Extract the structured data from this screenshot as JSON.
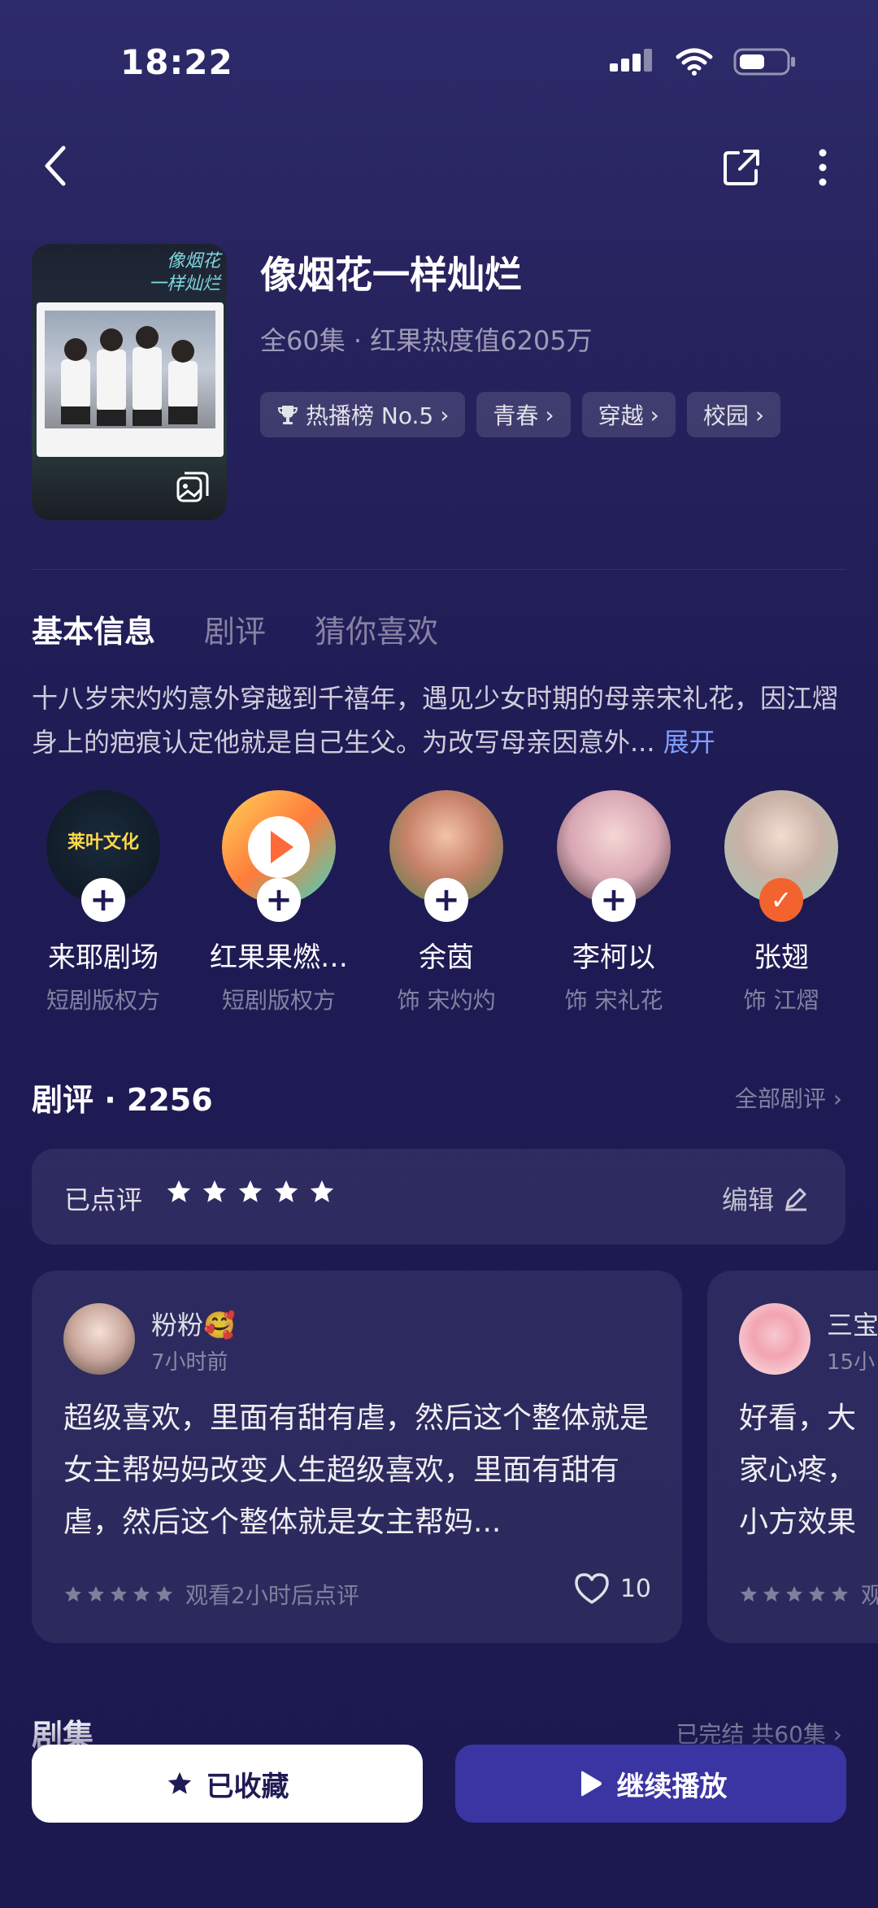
{
  "status_bar": {
    "time": "18:22"
  },
  "show": {
    "title": "像烟花一样灿烂",
    "meta": "全60集 · 红果热度值6205万",
    "poster_title_art": "像烟花\n一样灿烂",
    "tags": [
      {
        "label": "热播榜 No.5"
      },
      {
        "label": "青春"
      },
      {
        "label": "穿越"
      },
      {
        "label": "校园"
      }
    ]
  },
  "tabs": [
    {
      "label": "基本信息",
      "active": true
    },
    {
      "label": "剧评",
      "active": false
    },
    {
      "label": "猜你喜欢",
      "active": false
    }
  ],
  "synopsis": {
    "text": "十八岁宋灼灼意外穿越到千禧年，遇见少女时期的母亲宋礼花，因江熠身上的疤痕认定他就是自己生父。为改写母亲因意外...",
    "expand_label": "展开"
  },
  "cast": [
    {
      "name": "来耶剧场",
      "role": "短剧版权方",
      "avatar_text": "莱叶文化",
      "followed": false
    },
    {
      "name": "红果果燃…",
      "role": "短剧版权方",
      "followed": false
    },
    {
      "name": "余茵",
      "role": "饰 宋灼灼",
      "followed": false
    },
    {
      "name": "李柯以",
      "role": "饰 宋礼花",
      "followed": false
    },
    {
      "name": "张翅",
      "role": "饰 江熠",
      "followed": true
    }
  ],
  "reviews": {
    "title": "剧评 · 2256",
    "all_label": "全部剧评 ›",
    "rated_label": "已点评",
    "rated_stars": 5,
    "edit_label": "编辑",
    "items": [
      {
        "user": "粉粉🥰",
        "time": "7小时前",
        "body": "超级喜欢，里面有甜有虐，然后这个整体就是女主帮妈妈改变人生超级喜欢，里面有甜有虐，然后这个整体就是女主帮妈...",
        "footer": "观看2小时后点评",
        "likes": "10"
      },
      {
        "user": "三宝",
        "time": "15小",
        "body": "好看，大家心疼，小方效果也好看",
        "footer": "观"
      }
    ]
  },
  "episodes": {
    "title": "剧集",
    "status": "已完结 共60集 ›"
  },
  "actions": {
    "collect_label": "已收藏",
    "play_label": "继续播放"
  },
  "colors": {
    "accent_button": "#3b34a3",
    "follow_checked": "#f3632f",
    "expand_link": "#7f9fff"
  }
}
